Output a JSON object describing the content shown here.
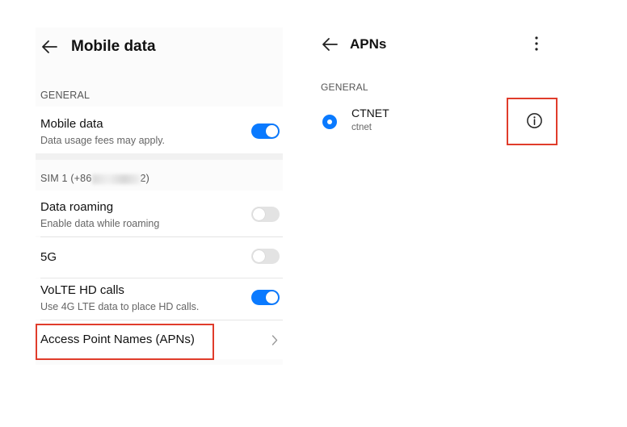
{
  "mobile_data_screen": {
    "title": "Mobile data",
    "general_label": "GENERAL",
    "mobile_data": {
      "title": "Mobile data",
      "subtitle": "Data usage fees may apply.",
      "enabled": true
    },
    "sim_label_prefix": "SIM 1 (+86",
    "sim_label_suffix": "2)",
    "data_roaming": {
      "title": "Data roaming",
      "subtitle": "Enable data while roaming",
      "enabled": false
    },
    "five_g": {
      "title": "5G",
      "enabled": false
    },
    "volte": {
      "title": "VoLTE HD calls",
      "subtitle": "Use 4G LTE data to place HD calls.",
      "enabled": true
    },
    "apn_row": {
      "title": "Access Point Names (APNs)"
    }
  },
  "apns_screen": {
    "title": "APNs",
    "general_label": "GENERAL",
    "apn": {
      "name": "CTNET",
      "apn": "ctnet",
      "selected": true
    }
  },
  "colors": {
    "accent": "#0a7aff",
    "highlight": "#e03c2b"
  }
}
